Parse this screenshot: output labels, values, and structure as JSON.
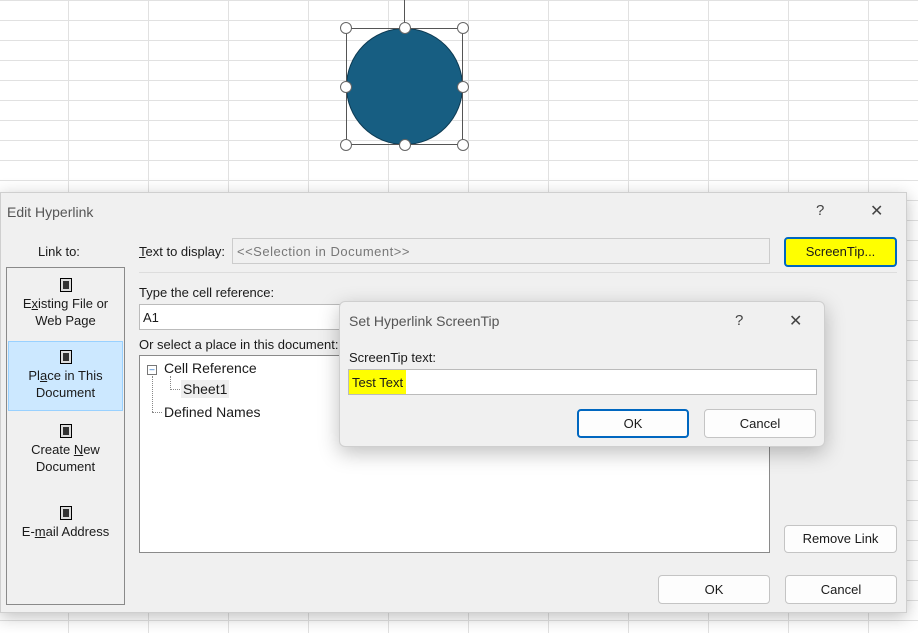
{
  "dialog": {
    "title": "Edit Hyperlink",
    "help": "?",
    "close": "✕",
    "link_to_label": "Link to:",
    "link_to_items": [
      {
        "label_a": "E",
        "label_u": "x",
        "label_b": "isting File or Web Page"
      },
      {
        "label_a": "Pl",
        "label_u": "a",
        "label_b": "ce in This Document"
      },
      {
        "label_a": "Create ",
        "label_u": "N",
        "label_b": "ew Document"
      },
      {
        "label_a": "E-",
        "label_u": "m",
        "label_b": "ail Address"
      }
    ],
    "text_to_display_label_u": "T",
    "text_to_display_label": "ext to display:",
    "text_to_display_value": "<<Selection in Document>>",
    "screentip_button": "ScreenTip...",
    "cell_ref_label": "Type the cell reference:",
    "cell_ref_value": "A1",
    "place_label": "Or select a place in this document:",
    "tree": {
      "root": "Cell Reference",
      "child": "Sheet1",
      "other": "Defined Names"
    },
    "remove_link": "Remove Link",
    "ok": "OK",
    "cancel": "Cancel"
  },
  "screentip_dialog": {
    "title": "Set Hyperlink ScreenTip",
    "help": "?",
    "close": "✕",
    "label": "ScreenTip text:",
    "value": "Test Text",
    "ok": "OK",
    "cancel": "Cancel"
  },
  "colors": {
    "shape": "#175e82",
    "highlight": "#ffff00",
    "selected": "#cce8ff"
  }
}
